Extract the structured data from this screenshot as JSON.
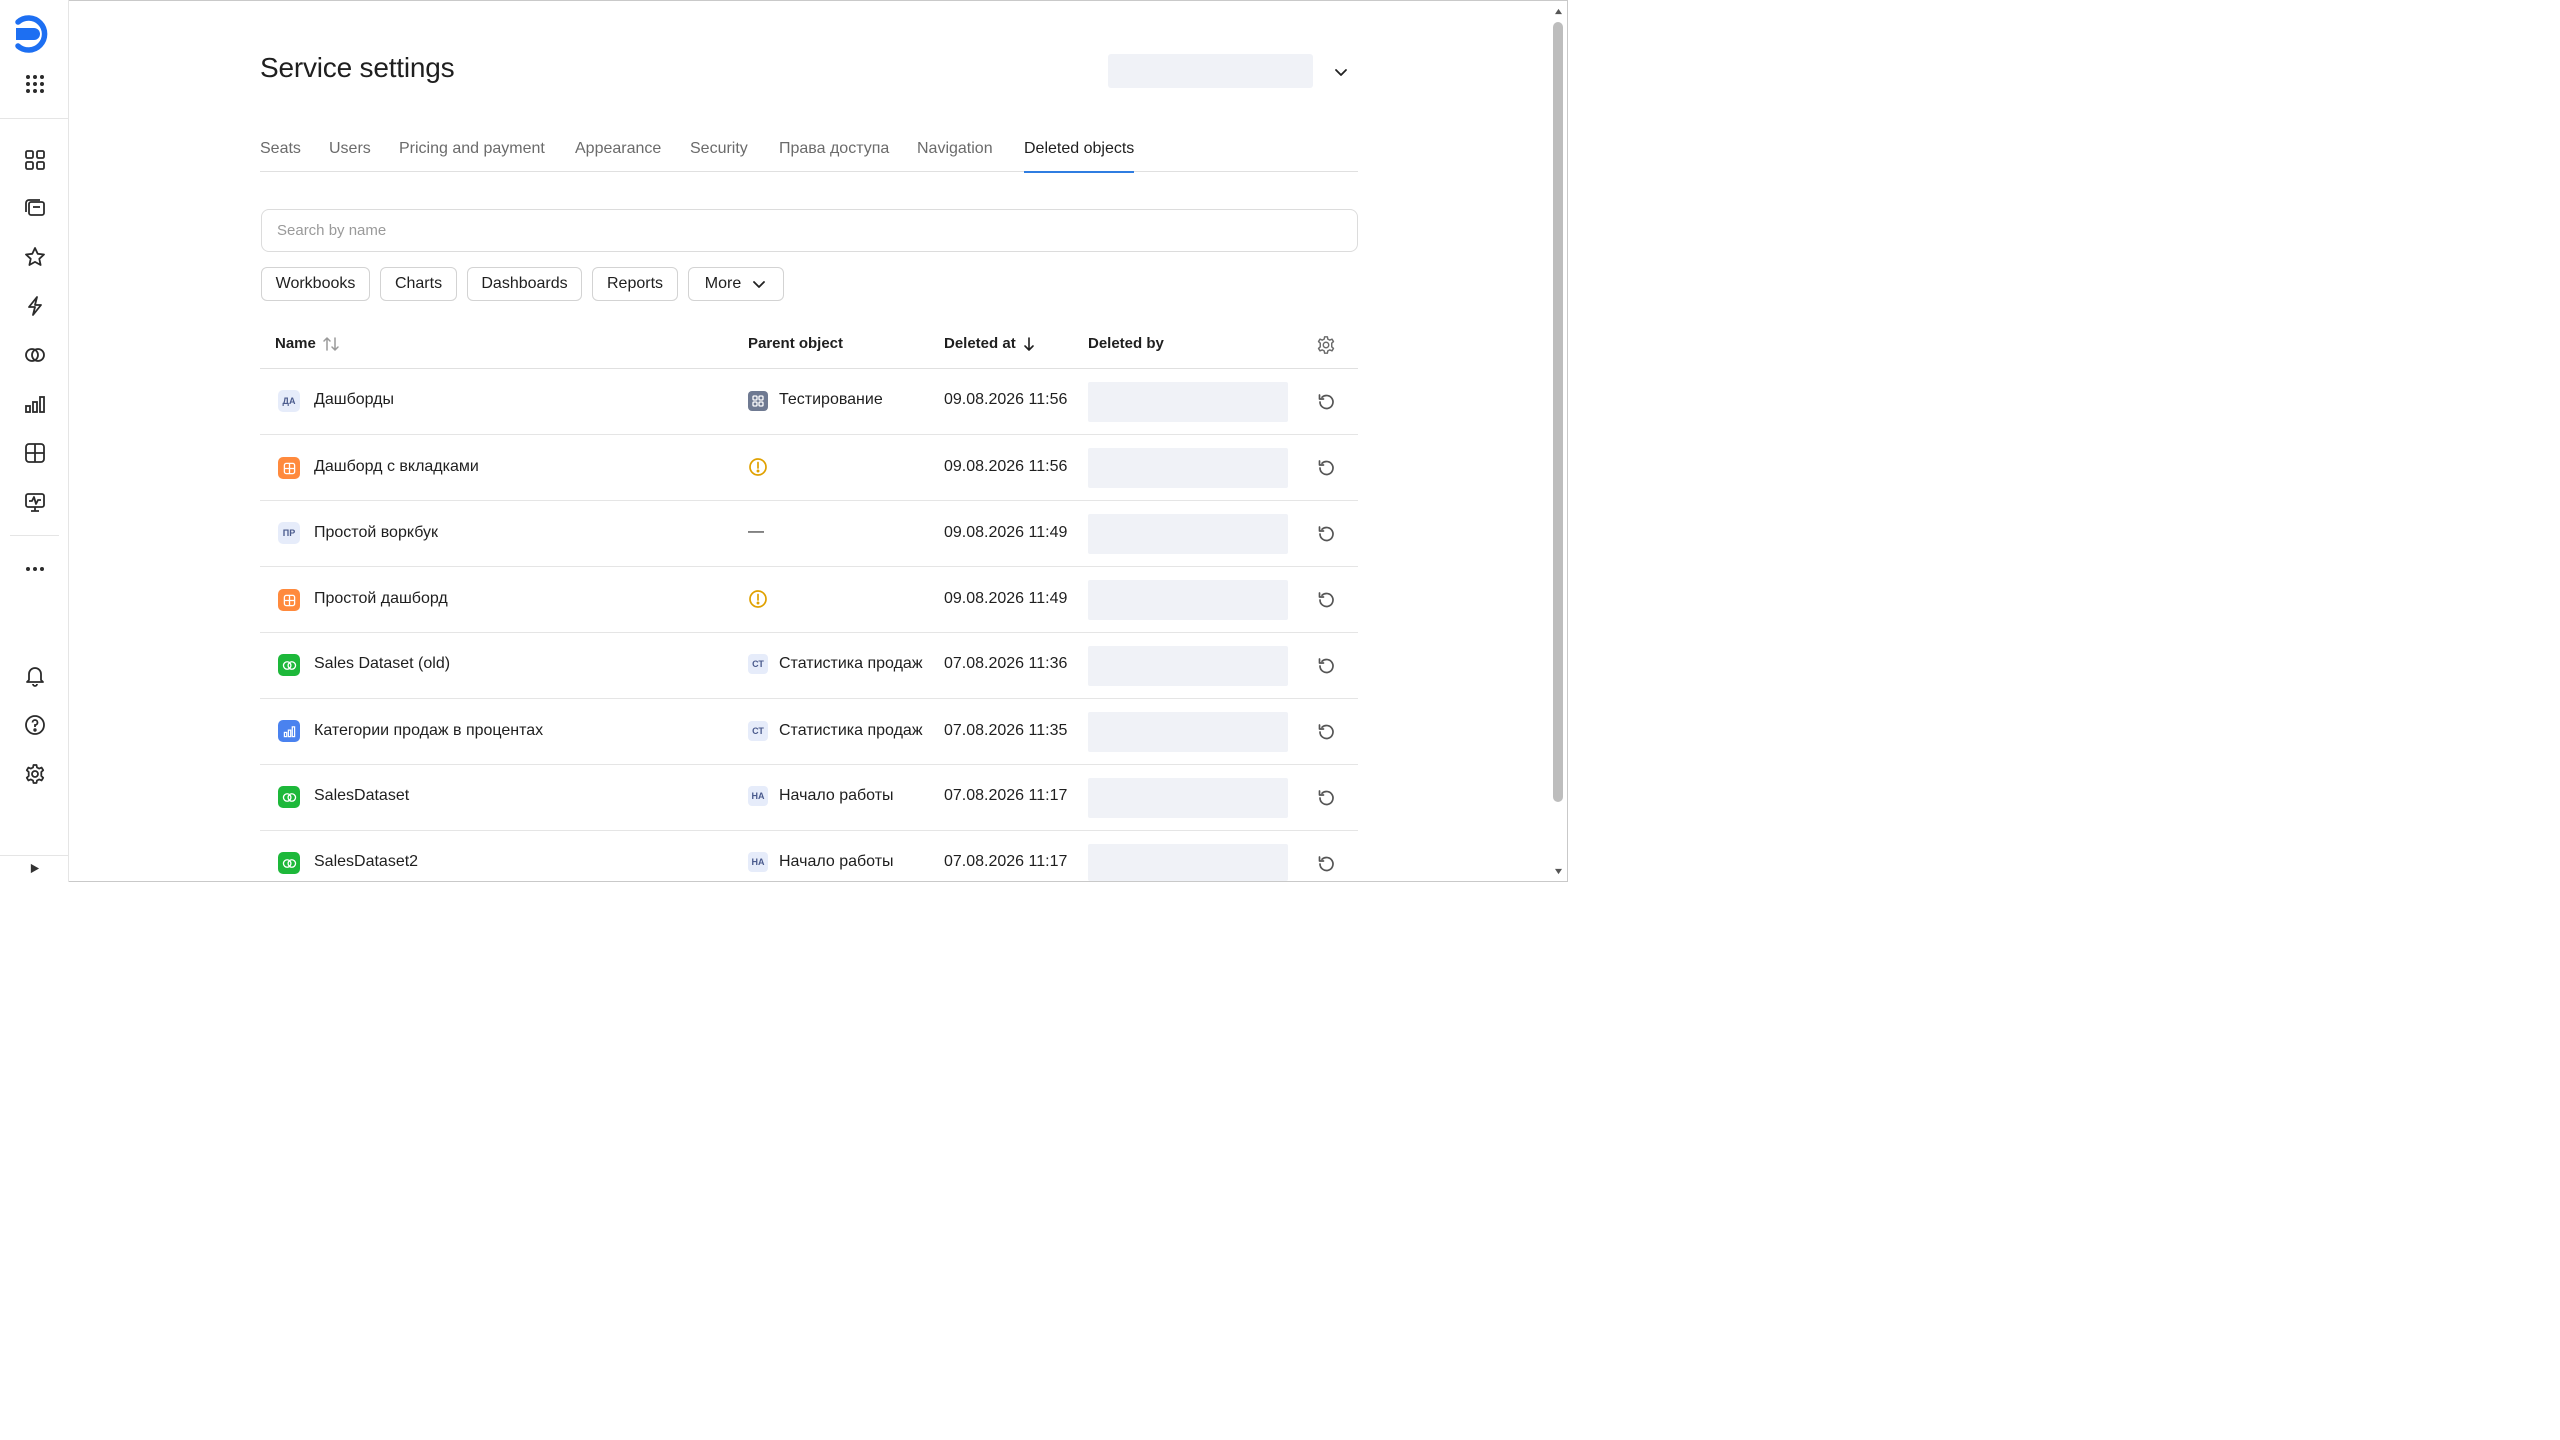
{
  "sidebar": {
    "logo": "datalens-logo-icon",
    "top_items": [
      "apps-grid-icon"
    ],
    "nav_items": [
      {
        "name": "collections-icon"
      },
      {
        "name": "workbooks-icon"
      },
      {
        "name": "favorites-star-icon"
      },
      {
        "name": "connections-bolt-icon"
      },
      {
        "name": "datasets-icon"
      },
      {
        "name": "charts-icon"
      },
      {
        "name": "dashboards-icon"
      },
      {
        "name": "reports-icon"
      },
      {
        "name": "more-dots-icon"
      }
    ],
    "bottom_items": [
      {
        "name": "notifications-bell-icon"
      },
      {
        "name": "help-icon"
      },
      {
        "name": "settings-gear-icon"
      }
    ]
  },
  "header": {
    "title": "Service settings"
  },
  "tabs": [
    {
      "label": "Seats"
    },
    {
      "label": "Users"
    },
    {
      "label": "Pricing and payment"
    },
    {
      "label": "Appearance"
    },
    {
      "label": "Security"
    },
    {
      "label": "Права доступа"
    },
    {
      "label": "Navigation"
    },
    {
      "label": "Deleted objects",
      "active": true
    }
  ],
  "search": {
    "placeholder": "Search by name",
    "value": ""
  },
  "filters": [
    {
      "label": "Workbooks"
    },
    {
      "label": "Charts"
    },
    {
      "label": "Dashboards"
    },
    {
      "label": "Reports"
    },
    {
      "label": "More"
    }
  ],
  "table": {
    "columns": {
      "name": "Name",
      "parent": "Parent object",
      "deleted_at": "Deleted at",
      "deleted_by": "Deleted by"
    },
    "rows": [
      {
        "type_abbr": "ДА",
        "type": "workbook",
        "name": "Дашборды",
        "parent_type": "collection",
        "parent_abbr": "",
        "parent": "Тестирование",
        "deleted_at": "09.08.2026 11:56"
      },
      {
        "type_abbr": "",
        "type": "dashboard",
        "name": "Дашборд с вкладками",
        "parent_type": "warning",
        "parent_abbr": "",
        "parent": "",
        "deleted_at": "09.08.2026 11:56"
      },
      {
        "type_abbr": "ПР",
        "type": "workbook",
        "name": "Простой воркбук",
        "parent_type": "none",
        "parent_abbr": "",
        "parent": "—",
        "deleted_at": "09.08.2026 11:49"
      },
      {
        "type_abbr": "",
        "type": "dashboard",
        "name": "Простой дашборд",
        "parent_type": "warning",
        "parent_abbr": "",
        "parent": "",
        "deleted_at": "09.08.2026 11:49"
      },
      {
        "type_abbr": "",
        "type": "dataset",
        "name": "Sales Dataset (old)",
        "parent_type": "workbook",
        "parent_abbr": "СТ",
        "parent": "Статистика продаж",
        "deleted_at": "07.08.2026 11:36"
      },
      {
        "type_abbr": "",
        "type": "chart",
        "name": "Категории продаж в процентах",
        "parent_type": "workbook",
        "parent_abbr": "СТ",
        "parent": "Статистика продаж",
        "deleted_at": "07.08.2026 11:35"
      },
      {
        "type_abbr": "",
        "type": "dataset",
        "name": "SalesDataset",
        "parent_type": "workbook",
        "parent_abbr": "НА",
        "parent": "Начало работы",
        "deleted_at": "07.08.2026 11:17"
      },
      {
        "type_abbr": "",
        "type": "dataset",
        "name": "SalesDataset2",
        "parent_type": "workbook",
        "parent_abbr": "НА",
        "parent": "Начало работы",
        "deleted_at": "07.08.2026 11:17"
      }
    ]
  },
  "colors": {
    "accent": "#2f7de1",
    "dashboard": "#ff8a3d",
    "dataset": "#1db83a",
    "chart": "#4a82ef",
    "warning": "#e0a100",
    "placeholder_bg": "#f0f2f7"
  }
}
